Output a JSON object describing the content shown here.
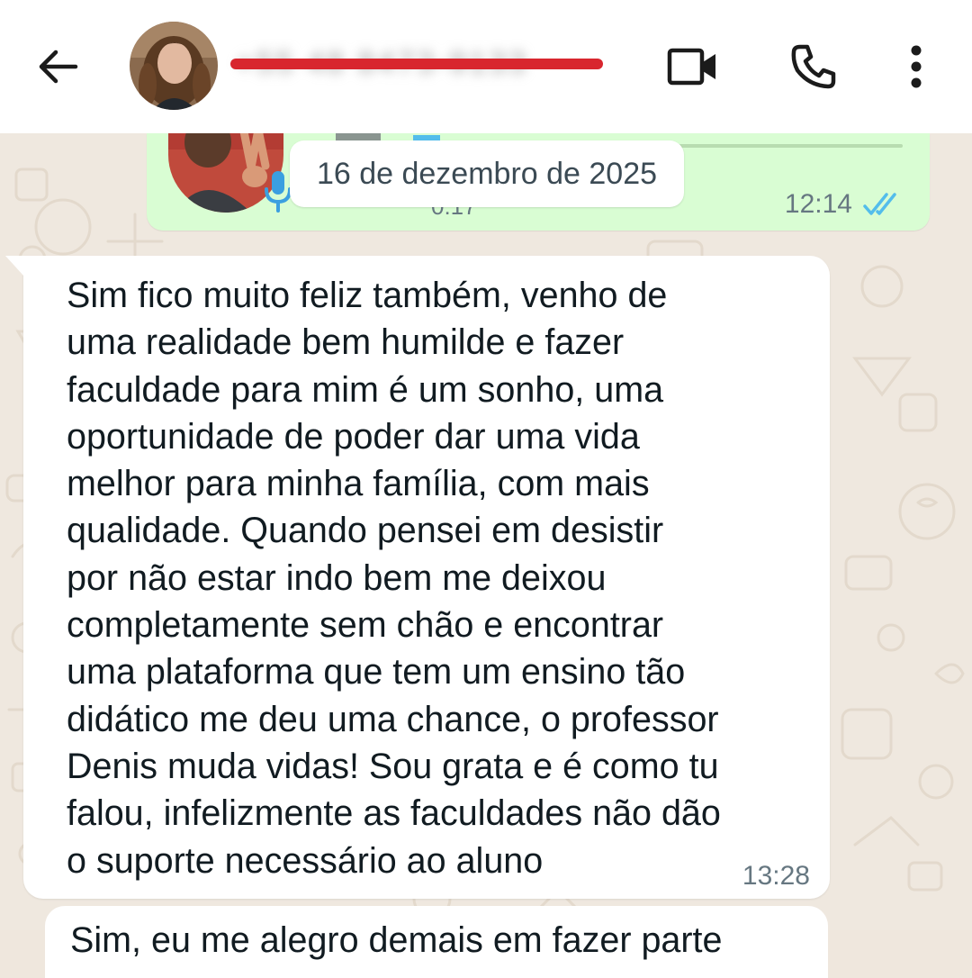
{
  "header": {
    "back_icon": "arrow-left-icon",
    "contact_name": "+55 48 8473-9133",
    "video_icon": "video-camera-icon",
    "call_icon": "phone-icon",
    "menu_icon": "more-vertical-icon",
    "redaction_color": "#d8262e"
  },
  "messages": {
    "outgoing_audio": {
      "duration": "0:17",
      "time": "12:14",
      "status_icon": "double-check-read-icon",
      "tick_color": "#53bdeb",
      "bubble_color": "#d9fdd3"
    },
    "date_separator": "16 de dezembro de 2025",
    "incoming_text": {
      "text": "Sim fico muito feliz também, venho de\numa realidade bem humilde e fazer\nfaculdade para mim é um sonho, uma\noportunidade de poder dar uma vida\nmelhor para minha família, com mais\nqualidade. Quando pensei em desistir\npor não estar indo bem me deixou\ncompletamente sem chão e encontrar\numa plataforma que tem um ensino tão\ndidático me deu uma chance, o professor\nDenis muda vidas! Sou grata e é como tu\nfalou, infelizmente as faculdades não dão\no suporte necessário ao aluno",
      "time": "13:28",
      "bubble_color": "#ffffff"
    },
    "next_incoming_partial": "Sim, eu me alegro demais em fazer parte"
  },
  "theme": {
    "wallpaper": "#efe8df",
    "text": "#111b21",
    "meta_text": "#667781"
  }
}
